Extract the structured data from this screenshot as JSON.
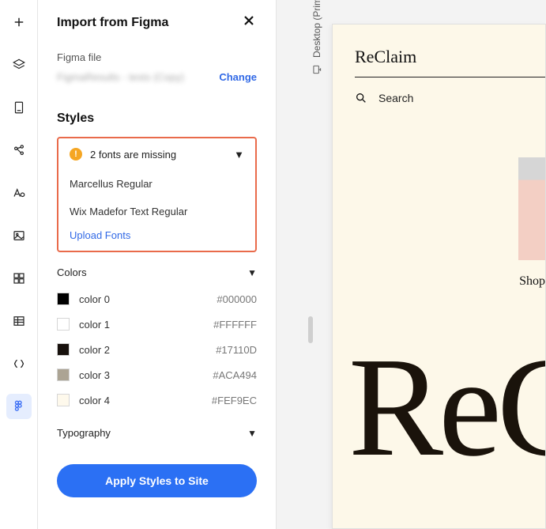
{
  "panel": {
    "title": "Import from Figma",
    "figmaFileLabel": "Figma file",
    "figmaFileName": "FigmaResults - tests (Copy)",
    "changeLabel": "Change",
    "stylesHeading": "Styles",
    "missing": {
      "summary": "2 fonts are missing",
      "fonts": [
        "Marcellus Regular",
        "Wix Madefor Text Regular"
      ],
      "uploadLabel": "Upload Fonts"
    },
    "colorsLabel": "Colors",
    "colors": [
      {
        "name": "color 0",
        "hex": "#000000"
      },
      {
        "name": "color 1",
        "hex": "#FFFFFF"
      },
      {
        "name": "color 2",
        "hex": "#17110D"
      },
      {
        "name": "color 3",
        "hex": "#ACA494"
      },
      {
        "name": "color 4",
        "hex": "#FEF9EC"
      }
    ],
    "typographyLabel": "Typography",
    "applyLabel": "Apply Styles to Site"
  },
  "canvas": {
    "orientationLabel": "Desktop (Primary)",
    "preview": {
      "brand": "ReClaim",
      "searchLabel": "Search",
      "shopLabel": "Shop",
      "heroText": "ReC"
    }
  }
}
